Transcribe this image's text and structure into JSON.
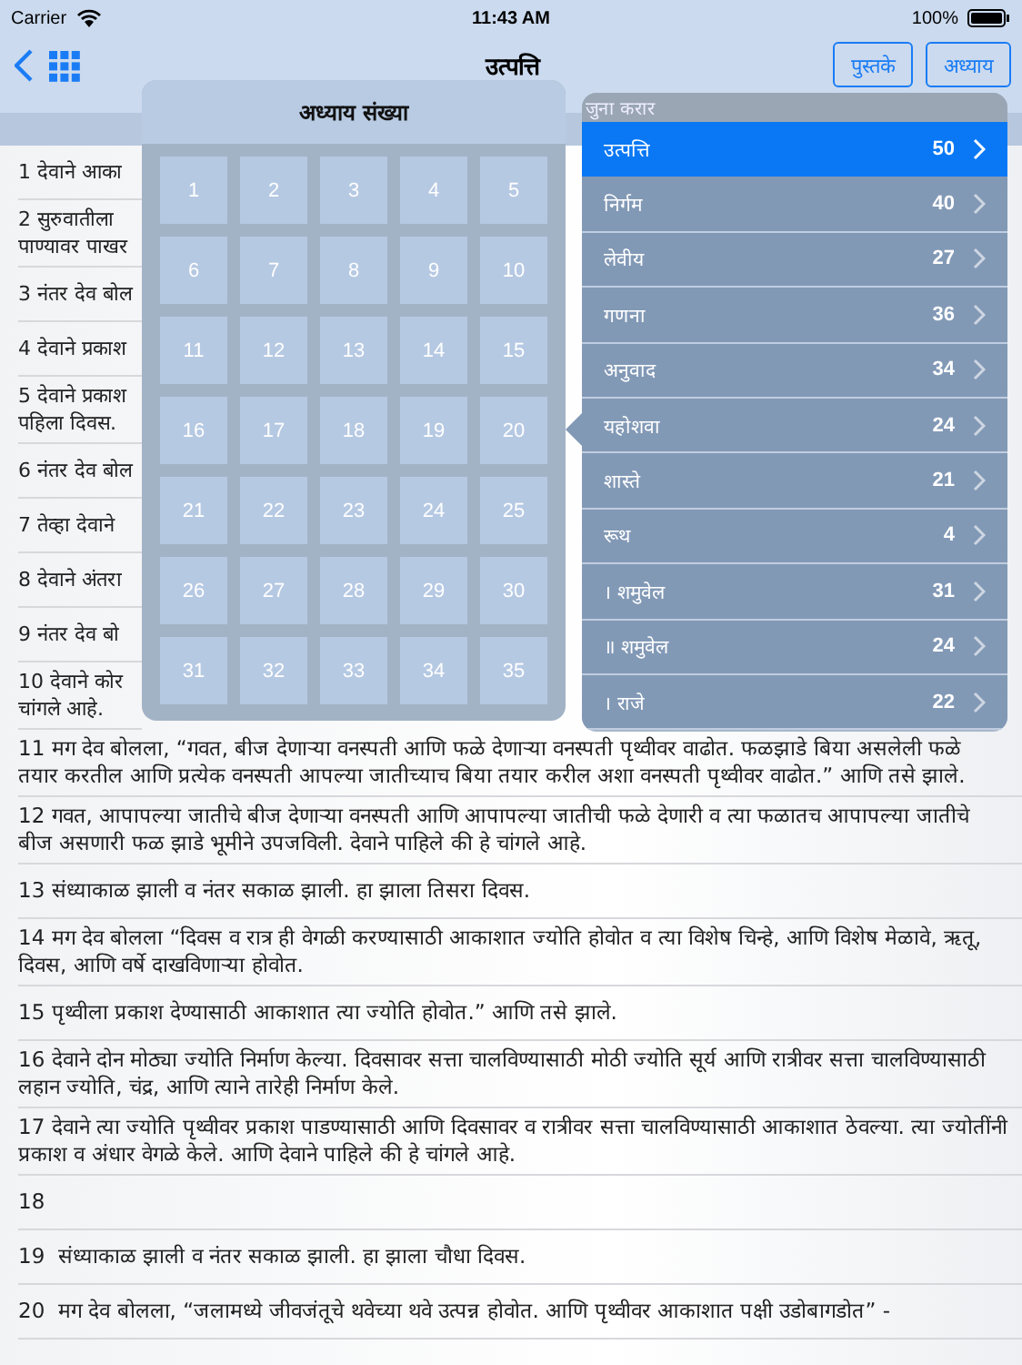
{
  "status_bar": {
    "carrier": "Carrier",
    "time": "11:43 AM",
    "battery": "100%"
  },
  "nav_bar": {
    "title": "उत्पत्ति",
    "buttons": [
      "पुस्तके",
      "अध्याय"
    ]
  },
  "verses": [
    {
      "text": "1 देवाने आका"
    },
    {
      "text": "2 सुरुवातीला\nपाण्यावर पाखर"
    },
    {
      "text": "3 नंतर देव बोल"
    },
    {
      "text": "4 देवाने प्रकाश"
    },
    {
      "text": "5 देवाने प्रकाश\nपहिला दिवस."
    },
    {
      "text": "6 नंतर देव बोल"
    },
    {
      "text": "7 तेव्हा देवाने"
    },
    {
      "text": "8 देवाने अंतरा"
    },
    {
      "text": "9 नंतर देव बो"
    },
    {
      "text": "10 देवाने कोर\nचांगले आहे."
    },
    {
      "text": "11 मग देव बोलला, “गवत, बीज देणाऱ्या वनस्पती आणि फळे देणाऱ्या वनस्पती पृथ्वीवर वाढोत. फळझाडे बिया असलेली फळे तयार करतील आणि प्रत्येक वनस्पती आपल्या जातीच्याच बिया तयार करील अशा वनस्पती पृथ्वीवर वाढोत.” आणि तसे झाले."
    },
    {
      "text": "12 गवत, आपापल्या जातीचे बीज देणाऱ्या वनस्पती आणि आपापल्या जातीची फळे देणारी व त्या फळातच आपापल्या जातीचे बीज असणारी फळ झाडे भूमीने उपजविली. देवाने पाहिले की हे चांगले आहे."
    },
    {
      "text": "13 संध्याकाळ झाली व नंतर सकाळ झाली. हा झाला तिसरा दिवस."
    },
    {
      "text": "14 मग देव बोलला “दिवस व रात्र ही वेगळी करण्यासाठी आकाशात ज्योति होवोत व त्या विशेष चिन्हे, आणि विशेष मेळावे, ऋतू, दिवस, आणि वर्षे दाखविणाऱ्या होवोत."
    },
    {
      "text": "15 पृथ्वीला प्रकाश देण्यासाठी आकाशात त्या ज्योति होवोत.” आणि तसे झाले."
    },
    {
      "text": "16 देवाने दोन मोठ्या ज्योति निर्माण केल्या. दिवसावर सत्ता चालविण्यासाठी मोठी ज्योति सूर्य आणि रात्रीवर सत्ता चालविण्यासाठी लहान ज्योति, चंद्र, आणि त्याने तारेही निर्माण केले."
    },
    {
      "text": "17 देवाने त्या ज्योति पृथ्वीवर प्रकाश पाडण्यासाठी आणि दिवसावर व रात्रीवर सत्ता चालविण्यासाठी आकाशात ठेवल्या. त्या ज्योतींनी प्रकाश व अंधार वेगळे केले. आणि देवाने पाहिले की हे चांगले आहे."
    },
    {
      "text": "18"
    },
    {
      "text": "19  संध्याकाळ झाली व नंतर सकाळ झाली. हा झाला चौधा दिवस."
    },
    {
      "text": "20  मग देव बोलला, “जलामध्ये जीवजंतूचे थवेच्या थवे उत्पन्न होवोत. आणि पृथ्वीवर आकाशात पक्षी उडोबागडोत” -"
    }
  ],
  "chapter_picker": {
    "title": "अध्याय संख्या",
    "chapters": [
      "1",
      "2",
      "3",
      "4",
      "5",
      "6",
      "7",
      "8",
      "9",
      "10",
      "11",
      "12",
      "13",
      "14",
      "15",
      "16",
      "17",
      "18",
      "19",
      "20",
      "21",
      "22",
      "23",
      "24",
      "25",
      "26",
      "27",
      "28",
      "29",
      "30",
      "31",
      "32",
      "33",
      "34",
      "35"
    ]
  },
  "book_list": {
    "section": "जुना करार",
    "books": [
      {
        "name": "उत्पत्ति",
        "chapters": "50",
        "selected": true
      },
      {
        "name": "निर्गम",
        "chapters": "40",
        "selected": false
      },
      {
        "name": "लेवीय",
        "chapters": "27",
        "selected": false
      },
      {
        "name": "गणना",
        "chapters": "36",
        "selected": false
      },
      {
        "name": "अनुवाद",
        "chapters": "34",
        "selected": false
      },
      {
        "name": "यहोशवा",
        "chapters": "24",
        "selected": false
      },
      {
        "name": "शास्ते",
        "chapters": "21",
        "selected": false
      },
      {
        "name": "रूथ",
        "chapters": "4",
        "selected": false
      },
      {
        "name": "। शमुवेल",
        "chapters": "31",
        "selected": false
      },
      {
        "name": "॥ शमुवेल",
        "chapters": "24",
        "selected": false
      },
      {
        "name": "। राजे",
        "chapters": "22",
        "selected": false
      }
    ]
  }
}
